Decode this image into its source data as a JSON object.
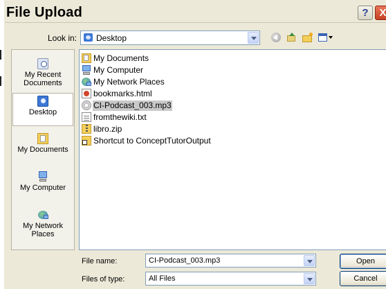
{
  "window": {
    "title": "File Upload",
    "help_label": "?",
    "close_label": "X"
  },
  "toolbar": {
    "look_in_label": "Look in:",
    "look_in_value": "Desktop",
    "icons": [
      "back-icon",
      "up-folder-icon",
      "new-folder-icon",
      "views-menu-icon"
    ]
  },
  "places": [
    {
      "label": "My Recent Documents",
      "icon": "recent-documents-icon"
    },
    {
      "label": "Desktop",
      "icon": "desktop-icon",
      "active": true
    },
    {
      "label": "My Documents",
      "icon": "my-documents-icon"
    },
    {
      "label": "My Computer",
      "icon": "my-computer-icon"
    },
    {
      "label": "My Network Places",
      "icon": "network-places-icon"
    }
  ],
  "files": [
    {
      "name": "My Documents",
      "icon": "my-documents-icon"
    },
    {
      "name": "My Computer",
      "icon": "my-computer-icon"
    },
    {
      "name": "My Network Places",
      "icon": "network-places-icon"
    },
    {
      "name": "bookmarks.html",
      "icon": "html-file-icon"
    },
    {
      "name": "CI-Podcast_003.mp3",
      "icon": "mp3-file-icon",
      "selected": true
    },
    {
      "name": "fromthewiki.txt",
      "icon": "text-file-icon"
    },
    {
      "name": "libro.zip",
      "icon": "zip-file-icon"
    },
    {
      "name": "Shortcut to ConceptTutorOutput",
      "icon": "shortcut-folder-icon"
    }
  ],
  "footer": {
    "file_name_label": "File name:",
    "file_name_value": "CI-Podcast_003.mp3",
    "files_of_type_label": "Files of type:",
    "files_of_type_value": "All Files",
    "open_label": "Open",
    "cancel_label": "Cancel"
  }
}
